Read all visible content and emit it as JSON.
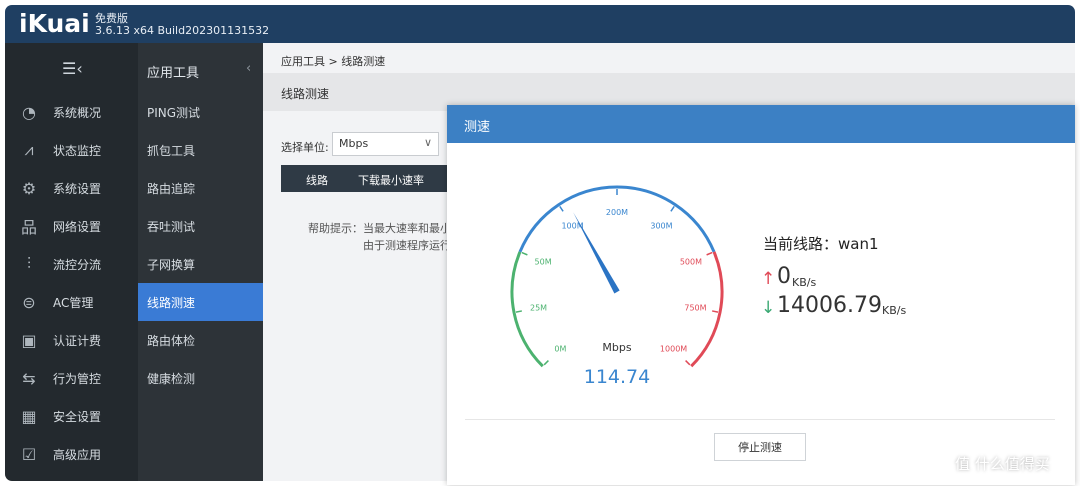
{
  "header": {
    "logo": "iKuai",
    "edition": "免费版",
    "version": "3.6.13 x64 Build202301131532"
  },
  "sidebar": {
    "collapse_icon": "menu-collapse-icon",
    "items": [
      {
        "label": "系统概况",
        "icon": "dashboard-icon"
      },
      {
        "label": "状态监控",
        "icon": "monitor-icon"
      },
      {
        "label": "系统设置",
        "icon": "gear-icon"
      },
      {
        "label": "网络设置",
        "icon": "network-icon"
      },
      {
        "label": "流控分流",
        "icon": "sliders-icon"
      },
      {
        "label": "AC管理",
        "icon": "wifi-icon"
      },
      {
        "label": "认证计费",
        "icon": "id-card-icon"
      },
      {
        "label": "行为管控",
        "icon": "swap-icon"
      },
      {
        "label": "安全设置",
        "icon": "firewall-icon"
      },
      {
        "label": "高级应用",
        "icon": "checkbox-icon"
      }
    ]
  },
  "subnav": {
    "title": "应用工具",
    "arrow": "‹",
    "items": [
      {
        "label": "PING测试"
      },
      {
        "label": "抓包工具"
      },
      {
        "label": "路由追踪"
      },
      {
        "label": "吞吐测试"
      },
      {
        "label": "子网换算"
      },
      {
        "label": "线路测速"
      },
      {
        "label": "路由体检"
      },
      {
        "label": "健康检测"
      }
    ],
    "active_index": 5
  },
  "content": {
    "breadcrumb": "应用工具 > 线路测速",
    "page_title": "线路测速",
    "unit_label": "选择单位:",
    "unit_value": "Mbps",
    "table_headers": [
      "线路",
      "下载最小速率"
    ],
    "tip_line1": "帮助提示：当最大速率和最小速",
    "tip_line2": "由于测速程序运行时"
  },
  "modal": {
    "title": "测速",
    "gauge": {
      "unit": "Mbps",
      "value": "114.74",
      "value_num": 114.74,
      "ticks": [
        "0M",
        "25M",
        "50M",
        "100M",
        "200M",
        "300M",
        "500M",
        "750M",
        "1000M"
      ]
    },
    "current_line_label": "当前线路：wan1",
    "upload_value": "0",
    "upload_unit": "KB/s",
    "download_value": "14006.79",
    "download_unit": "KB/s",
    "stop_button": "停止测速",
    "colors": {
      "green": "#4cb26f",
      "blue": "#3a86cf",
      "red": "#e04a57"
    }
  },
  "watermark": "值 什么值得买"
}
